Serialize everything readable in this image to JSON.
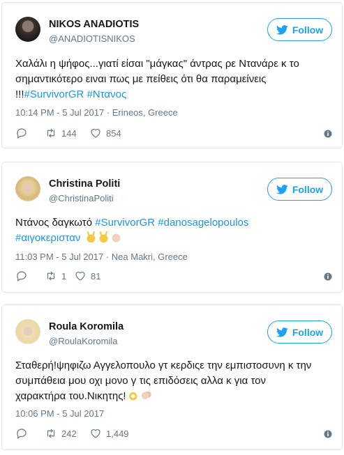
{
  "colors": {
    "accent": "#1da1f2",
    "hashtag": "#1b95e0",
    "muted": "#657786",
    "border": "#e1e8ed"
  },
  "follow_label": "Follow",
  "tweets": [
    {
      "author": "NIKOS ANADIOTIS",
      "handle": "@ANADIOTISNIKOS",
      "text_line1": "Χαλάλι η ψήφος...γιατί είσαι \"μάγκας\" άντρας ρε Ντανάρε κ το",
      "text_line2": "σημαντικότερο ειναι πως με πείθεις ότι θα παραμείνεις",
      "text_line3_plain": "!!!",
      "hashtag1": "#SurvivorGR",
      "hashtag2": "#Ντανος",
      "meta": "10:14 PM - 5 Jul 2017 · Erineos, Greece",
      "retweets": "144",
      "likes": "854"
    },
    {
      "author": "Christina Politi",
      "handle": "@ChristinaPoliti",
      "text_plain": "Ντάνος δαγκωτό ",
      "hashtag1": "#SurvivorGR",
      "hashtag2": "#danosagelopoulos",
      "hashtag3": "#αιγοκερισταν",
      "emojis": [
        "victory-hand",
        "victory-hand",
        "raised-fist"
      ],
      "meta": "11:03 PM - 5 Jul 2017 · Nea Makri, Greece",
      "retweets": "1",
      "likes": "81"
    },
    {
      "author": "Roula Koromila",
      "handle": "@RoulaKoromila",
      "text_line1": "Σταθερή!ψηφιζω Αγγελοπουλο γτ κερδιςε την εμπιστοσυνη κ την",
      "text_line2": "συμπάθεια μου οχι μονο γ τις επιδόσεις αλλα κ για τον",
      "text_line3": "χαρακτήρα του.Νικητης!",
      "emojis": [
        "ok-hand",
        "clapping-hands"
      ],
      "meta": "10:06 PM - 5 Jul 2017",
      "retweets": "242",
      "likes": "1,449"
    }
  ]
}
